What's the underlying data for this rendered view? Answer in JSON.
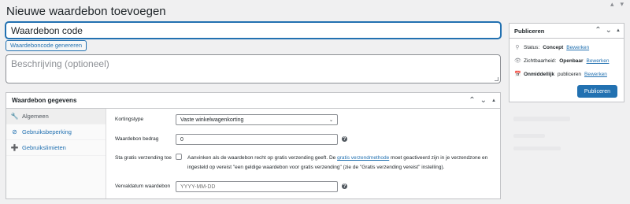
{
  "page": {
    "title": "Nieuwe waardebon toevoegen"
  },
  "coupon": {
    "code_value": "Waardebon code",
    "generate_label": "Waardeboncode genereren",
    "description_placeholder": "Beschrijving (optioneel)"
  },
  "data_panel": {
    "title": "Waardebon gegevens",
    "tabs": [
      {
        "label": "Algemeen",
        "icon": "wrench-icon",
        "active": true
      },
      {
        "label": "Gebruiksbeperking",
        "icon": "blocked-icon",
        "active": false
      },
      {
        "label": "Gebruikslimieten",
        "icon": "plus-icon",
        "active": false
      }
    ],
    "fields": {
      "discount_type_label": "Kortingstype",
      "discount_type_value": "Vaste winkelwagenkorting",
      "amount_label": "Waardebon bedrag",
      "amount_value": "0",
      "free_shipping_label": "Sta gratis verzending toe",
      "free_shipping_text_1": "Aanvinken als de waardebon recht op gratis verzending geeft. De",
      "free_shipping_link": "gratis verzendmethode",
      "free_shipping_text_2": "moet geactiveerd zijn in je verzendzone en ingesteld op vereist \"een geldige waardebon voor gratis verzending\" (zie de \"Gratis verzending vereist\" instelling).",
      "expiry_label": "Vervaldatum waardebon",
      "expiry_placeholder": "YYYY-MM-DD"
    }
  },
  "publish_box": {
    "title": "Publiceren",
    "status_label": "Status:",
    "status_value": "Concept",
    "status_edit": "Bewerken",
    "visibility_label": "Zichtbaarheid:",
    "visibility_value": "Openbaar",
    "visibility_edit": "Bewerken",
    "schedule_strong": "Onmiddellijk",
    "schedule_text": "publiceren",
    "schedule_edit": "Bewerken",
    "publish_button": "Publiceren"
  },
  "colors": {
    "accent": "#2271b1",
    "background": "#f0f0f1",
    "border": "#c3c4c7"
  }
}
